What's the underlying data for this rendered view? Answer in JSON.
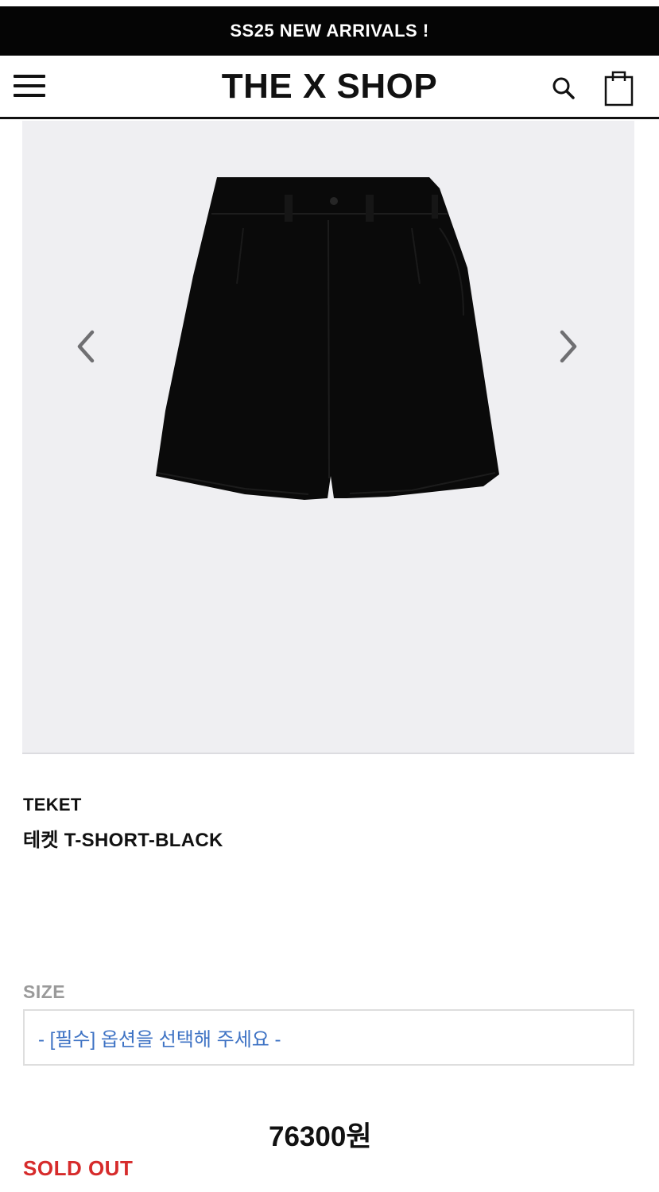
{
  "announcement": {
    "text": "SS25 NEW ARRIVALS !"
  },
  "header": {
    "logo": "THE X SHOP",
    "menu_icon": "hamburger-menu-icon",
    "search_icon": "search-icon",
    "cart_icon": "shopping-bag-icon"
  },
  "gallery": {
    "prev_icon": "chevron-left-icon",
    "next_icon": "chevron-right-icon",
    "image_subject": "black shorts"
  },
  "product": {
    "brand": "TEKET",
    "name": "테켓 T-SHORT-BLACK",
    "price": "76300원",
    "status": "SOLD OUT"
  },
  "options": {
    "size_label": "SIZE",
    "size_select_text": "- [필수] 옵션을 선택해 주세요 -"
  },
  "colors": {
    "announce_bg": "#050505",
    "gallery_bg": "#efeff2",
    "select_text": "#3d72c4",
    "sold_out": "#d62b2b",
    "muted_label": "#9a9a9a"
  }
}
